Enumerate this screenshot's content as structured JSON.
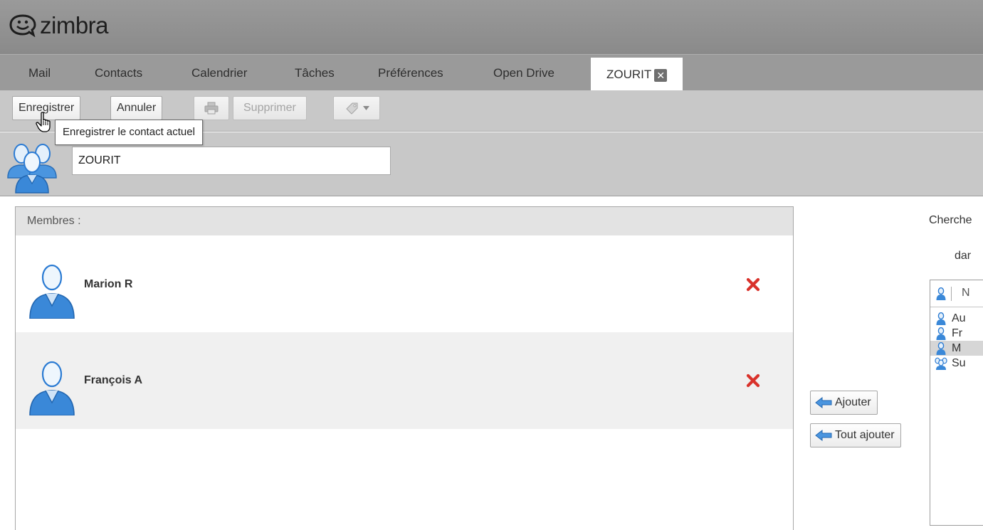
{
  "app": {
    "logo_text": "zimbra"
  },
  "tabs": [
    {
      "label": "Mail"
    },
    {
      "label": "Contacts"
    },
    {
      "label": "Calendrier"
    },
    {
      "label": "Tâches"
    },
    {
      "label": "Préférences"
    },
    {
      "label": "Open Drive"
    },
    {
      "label": "ZOURIT"
    }
  ],
  "toolbar": {
    "save_label": "Enregistrer",
    "cancel_label": "Annuler",
    "delete_label": "Supprimer",
    "tooltip": "Enregistrer le contact actuel"
  },
  "group": {
    "name_value": "ZOURIT"
  },
  "members": {
    "header": "Membres :",
    "items": [
      {
        "name": "Marion R"
      },
      {
        "name": "François A"
      }
    ]
  },
  "actions": {
    "add_label": "Ajouter",
    "add_all_label": "Tout ajouter"
  },
  "search": {
    "label": "Cherche",
    "in_label": "dar",
    "header_partial": "N",
    "results": [
      {
        "text": "Au",
        "type": "contact"
      },
      {
        "text": "Fr",
        "type": "contact"
      },
      {
        "text": "M",
        "type": "contact"
      },
      {
        "text": "Su",
        "type": "group"
      }
    ]
  },
  "colors": {
    "accent_blue": "#2b7bd3",
    "remove_red": "#d9322b"
  }
}
